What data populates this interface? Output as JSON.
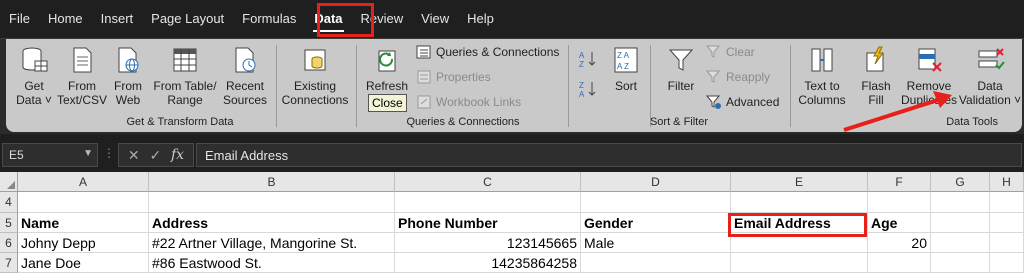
{
  "menu": {
    "tabs": [
      "File",
      "Home",
      "Insert",
      "Page Layout",
      "Formulas",
      "Data",
      "Review",
      "View",
      "Help"
    ],
    "active": "Data"
  },
  "ribbon": {
    "get_transform": {
      "get_data": "Get\nData ˅",
      "from_text_csv": "From\nText/CSV",
      "from_web": "From\nWeb",
      "from_table_range": "From Table/\nRange",
      "recent_sources": "Recent\nSources",
      "existing_connections": "Existing\nConnections",
      "label": "Get & Transform Data"
    },
    "queries": {
      "refresh_all": "Refresh\nAll ˅",
      "queries_connections": "Queries & Connections",
      "properties": "Properties",
      "workbook_links": "Workbook Links",
      "label": "Queries & Connections",
      "tooltip": "Close"
    },
    "sort_filter": {
      "sort": "Sort",
      "filter": "Filter",
      "clear": "Clear",
      "reapply": "Reapply",
      "advanced": "Advanced",
      "label": "Sort & Filter"
    },
    "data_tools": {
      "text_to_columns": "Text to\nColumns",
      "flash_fill": "Flash\nFill",
      "remove_duplicates": "Remove\nDuplicates",
      "data_validation": "Data\nValidation ˅",
      "label": "Data Tools"
    }
  },
  "formula_bar": {
    "name_box": "E5",
    "formula": "Email Address",
    "fx": "fx"
  },
  "sheet": {
    "columns": [
      "A",
      "B",
      "C",
      "D",
      "E",
      "F",
      "G",
      "H"
    ],
    "rows": [
      {
        "num": "4",
        "cells": [
          "",
          "",
          "",
          "",
          "",
          "",
          "",
          ""
        ]
      },
      {
        "num": "5",
        "cells": [
          "Name",
          "Address",
          "Phone Number",
          "Gender",
          "Email Address",
          "Age",
          "",
          ""
        ]
      },
      {
        "num": "6",
        "cells": [
          "Johny Depp",
          "#22 Artner Village, Mangorine St.",
          "123145665",
          "Male",
          "",
          "20",
          "",
          ""
        ]
      },
      {
        "num": "7",
        "cells": [
          "Jane Doe",
          "#86 Eastwood St.",
          "14235864258",
          "",
          "",
          "",
          "",
          ""
        ]
      }
    ]
  },
  "colors": {
    "highlight": "#e8201c",
    "ribbon_bg": "#c9c9c9",
    "chrome": "#1f1f1f"
  }
}
